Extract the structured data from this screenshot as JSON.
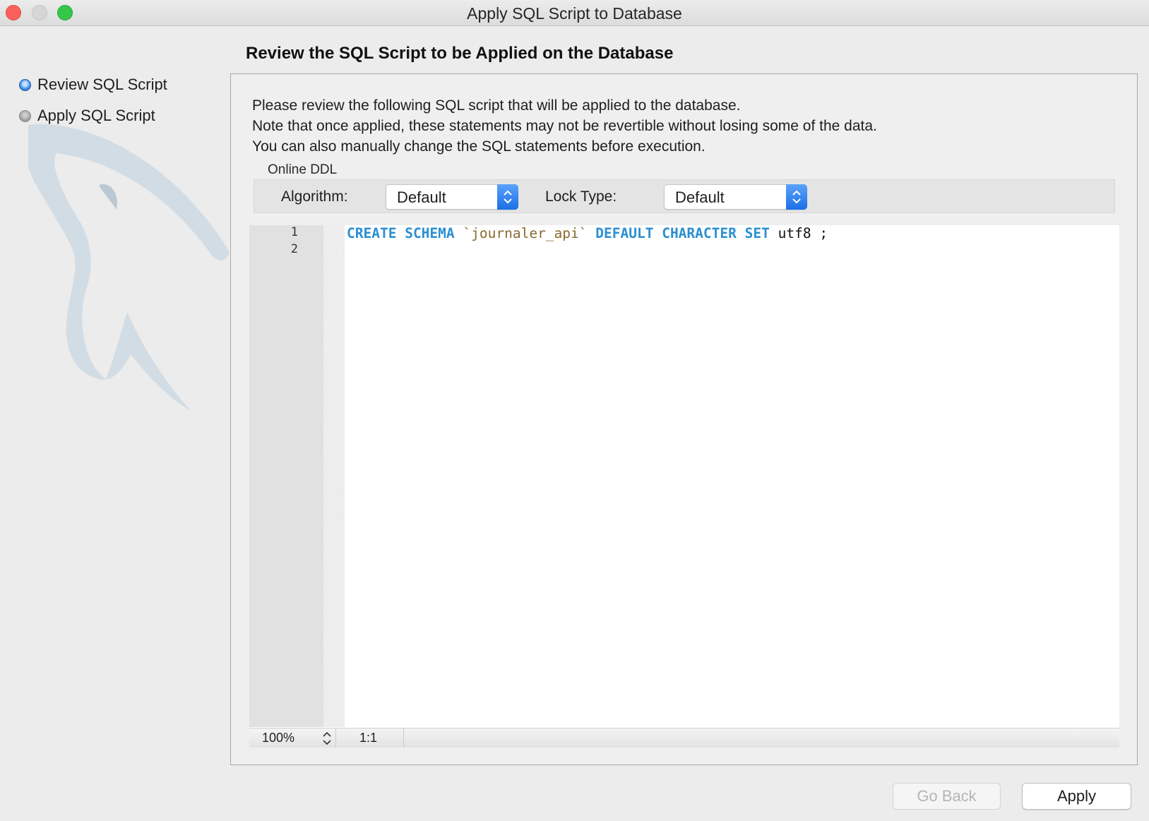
{
  "window": {
    "title": "Apply SQL Script to Database"
  },
  "sidebar": {
    "steps": [
      {
        "label": "Review SQL Script",
        "state": "active"
      },
      {
        "label": "Apply SQL Script",
        "state": "pending"
      }
    ]
  },
  "main": {
    "heading": "Review the SQL Script to be Applied on the Database",
    "description": [
      "Please review the following SQL script that will be applied to the database.",
      "Note that once applied, these statements may not be revertible without losing some of the data.",
      "You can also manually change the SQL statements before execution."
    ],
    "online_ddl": {
      "label": "Online DDL",
      "algorithm_label": "Algorithm:",
      "algorithm_value": "Default",
      "lock_type_label": "Lock Type:",
      "lock_type_value": "Default"
    }
  },
  "editor": {
    "line_numbers": [
      "1",
      "2"
    ],
    "tokens": {
      "create": "CREATE",
      "schema": "SCHEMA",
      "schema_name": "`journaler_api`",
      "default": "DEFAULT",
      "character": "CHARACTER",
      "set": "SET",
      "charset": "utf8",
      "terminator": ";"
    },
    "zoom": "100%",
    "cursor_position": "1:1"
  },
  "buttons": {
    "go_back": "Go Back",
    "apply": "Apply"
  },
  "colors": {
    "keyword": "#2b8fd1",
    "identifier": "#8a6a2e",
    "accent": "#1b6fe6",
    "close": "#fc605b",
    "maximize": "#34c748"
  }
}
